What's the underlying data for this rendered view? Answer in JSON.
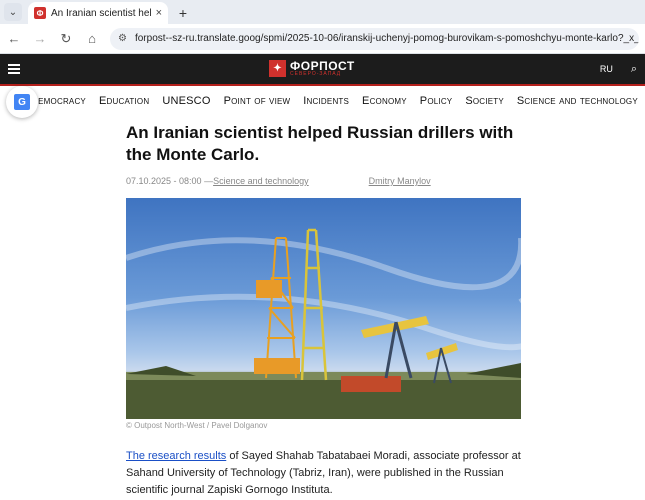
{
  "browser": {
    "tab_title": "An Iranian scientist helped Russ",
    "tab_favicon_glyph": "Ф",
    "tab_close": "×",
    "new_tab": "+",
    "tab_menu": "⌄",
    "url": "forpost--sz-ru.translate.goog/spmi/2025-10-06/iranskij-uchenyj-pomog-burovikam-s-pomoshchyu-monte-karlo?_x_tr_sl=ru&_x_tr_tl=en&_x_t"
  },
  "site": {
    "brand": "ФОРПОСТ",
    "tagline": "СЕВЕРО-ЗАПАД",
    "language": "RU",
    "brand_color": "#d0312d"
  },
  "sections": [
    "Democracy",
    "Education",
    "UNESCO",
    "Point of view",
    "Incidents",
    "Economy",
    "Policy",
    "Society",
    "Science and technology"
  ],
  "article": {
    "headline": "An Iranian scientist helped Russian drillers with the Monte Carlo.",
    "date": "07.10.2025 - 08:00 —",
    "category": "Science and technology",
    "author": "Dmitry Manylov",
    "photo_caption": "© Outpost North-West / Pavel Dolganov",
    "body_link": "The research results",
    "body_text": " of Sayed Shahab Tabatabaei Moradi, associate professor at Sahand University of Technology (Tabriz, Iran), were published in the Russian scientific journal Zapiski Gornogo Instituta."
  }
}
